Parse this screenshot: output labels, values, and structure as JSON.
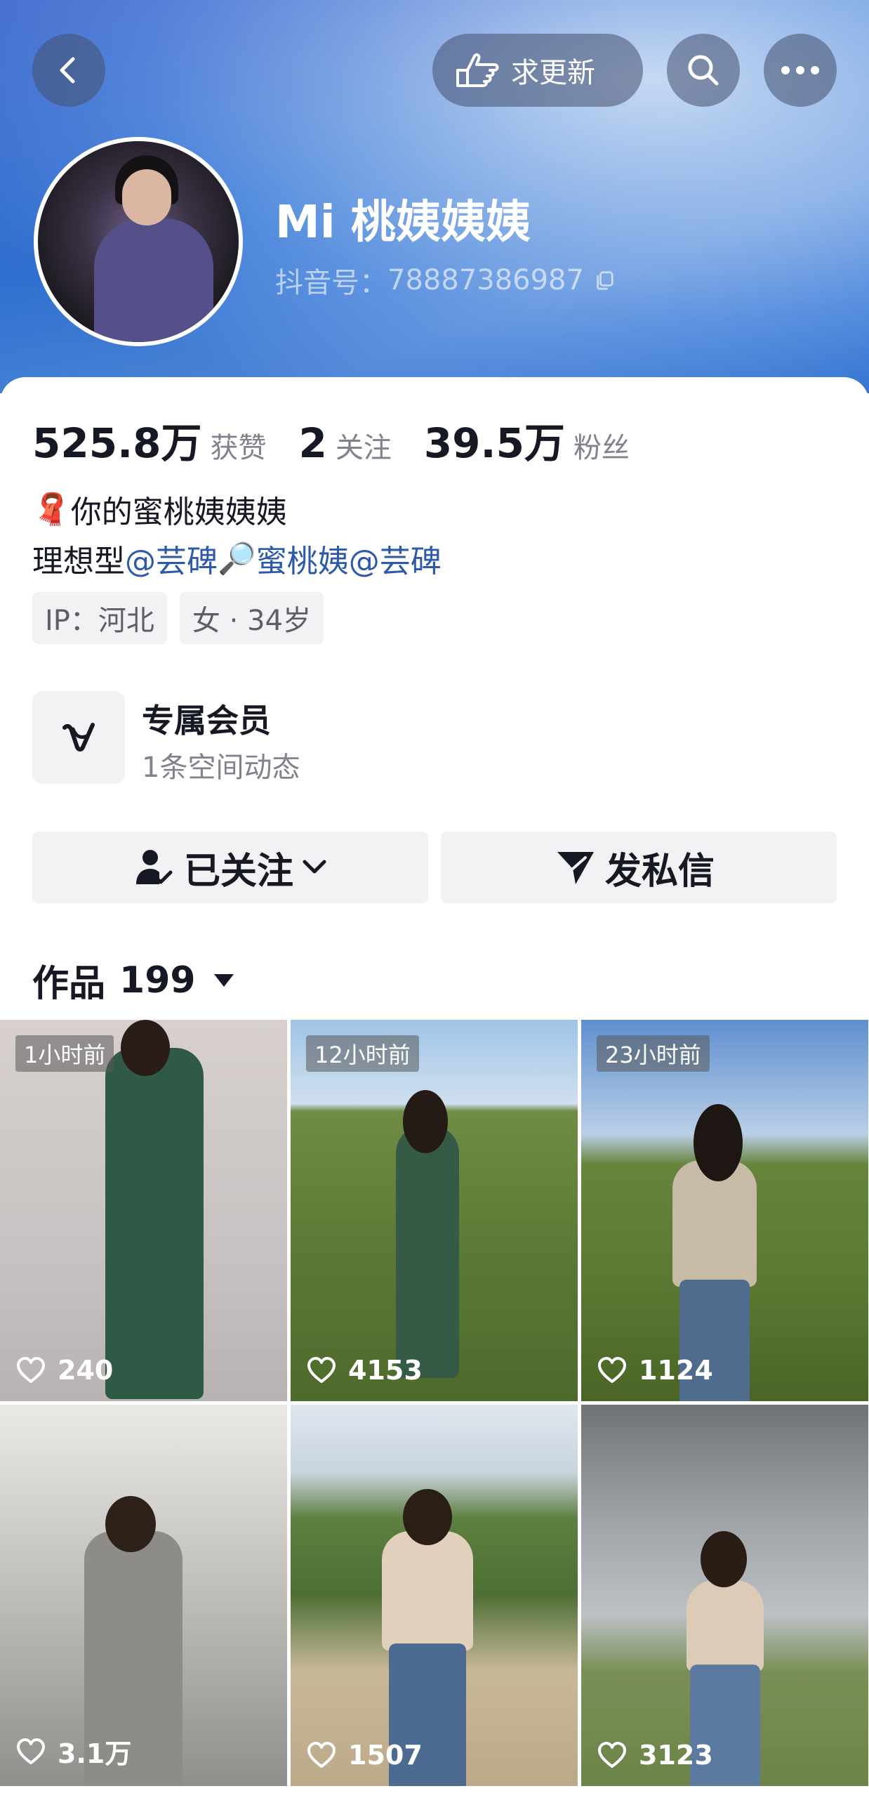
{
  "header": {
    "update_label": "求更新",
    "nickname": "Mi 桃姨姨姨",
    "douyin_id_label": "抖音号：",
    "douyin_id": "78887386987"
  },
  "stats": [
    {
      "value": "525.8万",
      "label": "获赞"
    },
    {
      "value": "2",
      "label": "关注"
    },
    {
      "value": "39.5万",
      "label": "粉丝"
    }
  ],
  "bio": {
    "line1_emoji": "🧣",
    "line1_text": "你的蜜桃姨姨姨",
    "line2_prefix": "理想型",
    "mention1": "@芸碑",
    "magnifier_emoji": "🔎",
    "mention2_text": "蜜桃姨",
    "mention3": "@芸碑"
  },
  "tags": [
    "IP：河北",
    "女 · 34岁"
  ],
  "membership": {
    "title": "专属会员",
    "subtitle": "1条空间动态"
  },
  "actions": {
    "follow_label": "已关注",
    "message_label": "发私信"
  },
  "works": {
    "label": "作品",
    "count": "199"
  },
  "videos": [
    {
      "badge": "1小时前",
      "likes": "240"
    },
    {
      "badge": "12小时前",
      "likes": "4153"
    },
    {
      "badge": "23小时前",
      "likes": "1124"
    },
    {
      "badge": "",
      "likes": "3.1万"
    },
    {
      "badge": "",
      "likes": "1507"
    },
    {
      "badge": "",
      "likes": "3123"
    }
  ],
  "colors": {
    "mention": "#2d5aa8",
    "header_blue": "#3275d2",
    "text_primary": "#161823",
    "text_secondary": "#80838c"
  }
}
